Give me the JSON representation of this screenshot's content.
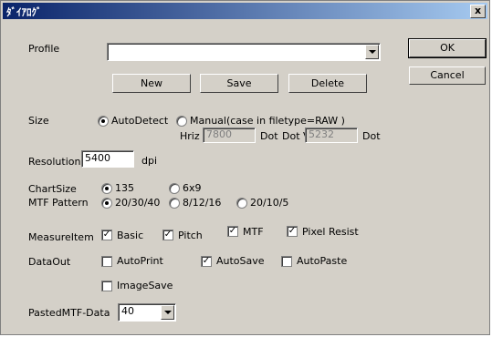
{
  "window": {
    "title": "ﾀﾞｲｱﾛｸﾞ",
    "close_label": "x"
  },
  "profile": {
    "label": "Profile",
    "value": ""
  },
  "buttons": {
    "ok": "OK",
    "cancel": "Cancel",
    "new": "New",
    "save": "Save",
    "delete": "Delete"
  },
  "size": {
    "label": "Size",
    "option_auto": "AutoDetect",
    "option_manual": "Manual(case in filetype=RAW )",
    "hriz_label": "Hriz",
    "hriz_value": "7800",
    "dot_label": "Dot",
    "vert_label": "Dot Vert",
    "vert_value": "5232",
    "dot_label2": "Dot"
  },
  "resolution": {
    "label": "Resolution",
    "value": "5400",
    "unit": "dpi"
  },
  "chartsize": {
    "label": "ChartSize",
    "opt1": "135",
    "opt2": "6x9"
  },
  "mtf_pattern": {
    "label": "MTF Pattern",
    "opt1": "20/30/40",
    "opt2": "8/12/16",
    "opt3": "20/10/5"
  },
  "measure": {
    "label": "MeasureItem",
    "basic": "Basic",
    "pitch": "Pitch",
    "mtf": "MTF",
    "pixel": "Pixel Resist"
  },
  "dataout": {
    "label": "DataOut",
    "autoprint": "AutoPrint",
    "autosave": "AutoSave",
    "autopaste": "AutoPaste",
    "imagesave": "ImageSave"
  },
  "pasted": {
    "label": "PastedMTF-Data",
    "value": "40"
  },
  "check_mark": "✓"
}
